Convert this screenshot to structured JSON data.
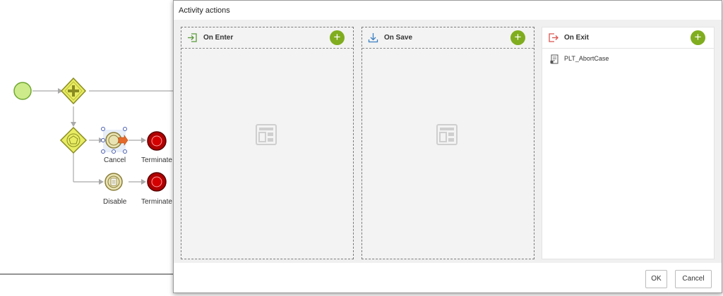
{
  "canvas": {
    "labels": {
      "cancel": "Cancel",
      "terminate_1": "Terminate",
      "disable": "Disable",
      "terminate_2": "Terminate"
    }
  },
  "dialog": {
    "title": "Activity actions",
    "columns": [
      {
        "title": "On Enter",
        "icon": "enter-icon",
        "items": []
      },
      {
        "title": "On Save",
        "icon": "save-download-icon",
        "items": []
      },
      {
        "title": "On Exit",
        "icon": "exit-icon",
        "items": [
          {
            "label": "PLT_AbortCase",
            "icon": "rule-script-icon"
          }
        ]
      }
    ],
    "buttons": {
      "ok": "OK",
      "cancel": "Cancel"
    }
  },
  "colors": {
    "accent_green": "#80ad1f",
    "exit_icon": "#d9534f",
    "save_icon": "#3a7fc1",
    "enter_icon": "#5a9a3a",
    "terminate": "#b00000",
    "gateway": "#d8df4e"
  }
}
